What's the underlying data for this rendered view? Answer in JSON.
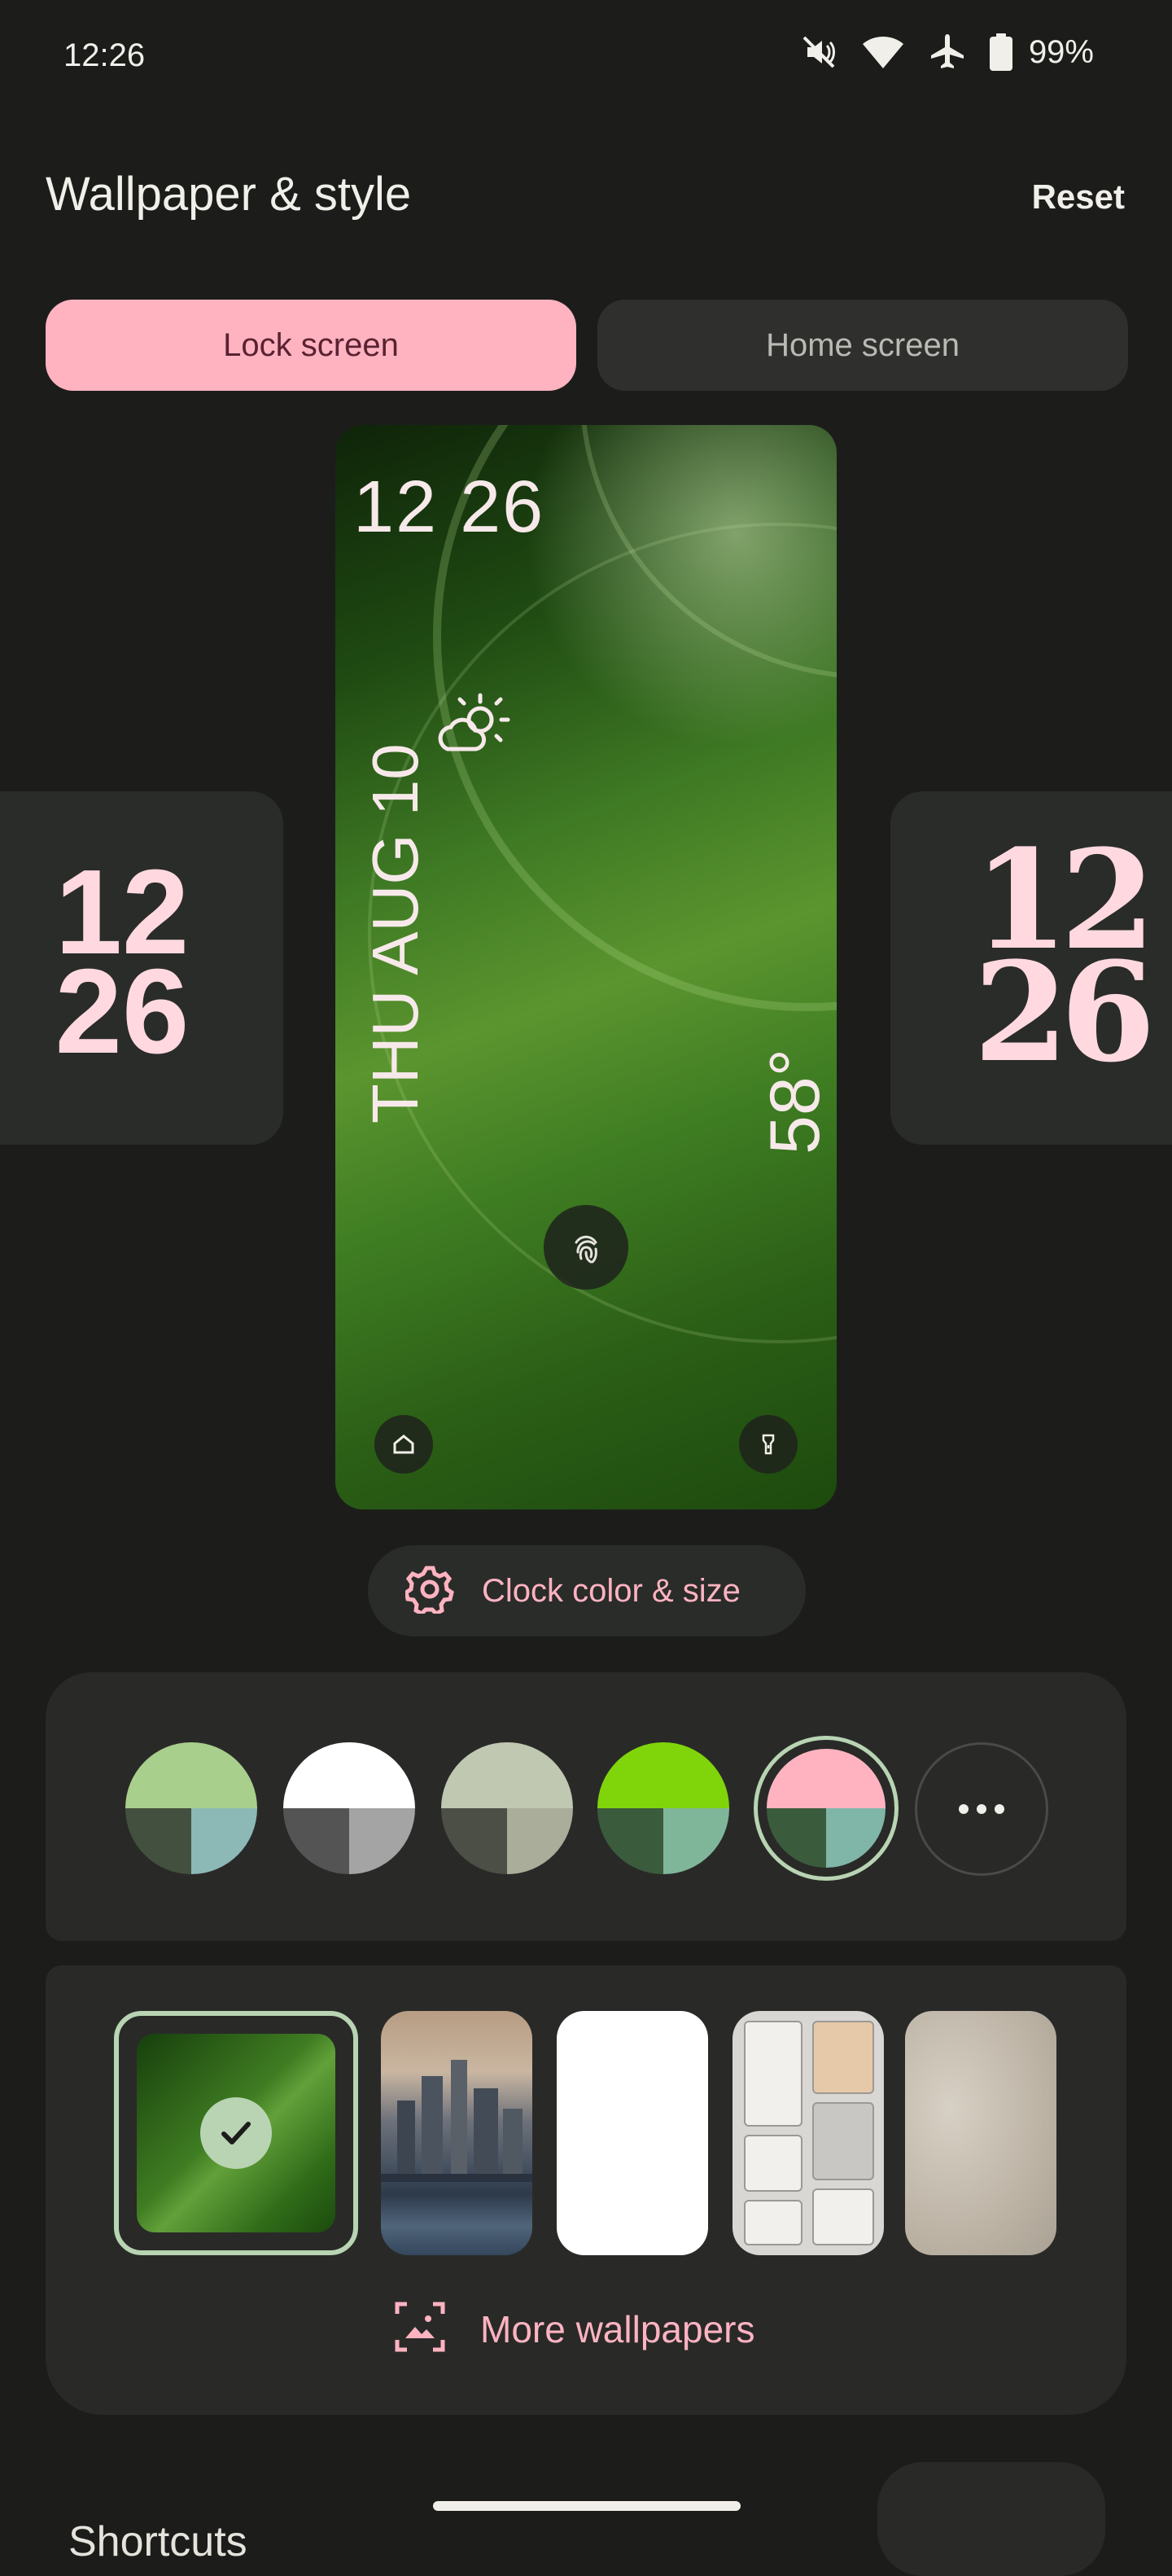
{
  "status_bar": {
    "time": "12:26",
    "battery": "99%",
    "icons": [
      "mute-icon",
      "wifi-icon",
      "airplane-icon",
      "battery-icon"
    ]
  },
  "header": {
    "title": "Wallpaper & style",
    "reset": "Reset"
  },
  "tabs": [
    {
      "label": "Lock screen",
      "selected": true
    },
    {
      "label": "Home screen",
      "selected": false
    }
  ],
  "clock_previews": {
    "left": {
      "hour": "12",
      "minute": "26"
    },
    "right": {
      "hour": "12",
      "minute": "26"
    }
  },
  "lock_preview": {
    "time": "12 26",
    "date": "THU AUG 10",
    "temperature": "58°",
    "weather_icon": "partly-sunny-icon",
    "controls": [
      "fingerprint-icon",
      "home-icon",
      "flashlight-icon"
    ]
  },
  "clock_color_button": {
    "label": "Clock color & size",
    "icon": "gear-icon"
  },
  "color_options": [
    {
      "top": "#a9cf8c",
      "bottom_left": "#43503f",
      "bottom_right": "#8cb8b6",
      "selected": false
    },
    {
      "top": "#ffffff",
      "bottom_left": "#545454",
      "bottom_right": "#a4a4a4",
      "selected": false
    },
    {
      "top": "#c0c8b2",
      "bottom_left": "#4b4f45",
      "bottom_right": "#a9ad99",
      "selected": false
    },
    {
      "top": "#7fd50a",
      "bottom_left": "#3b5b3d",
      "bottom_right": "#7fb69a",
      "selected": false
    },
    {
      "top": "#ffb3c1",
      "bottom_left": "#3b5b3d",
      "bottom_right": "#7fb6a8",
      "selected": true
    }
  ],
  "more_colors_icon": "more-horizontal-icon",
  "wallpapers": {
    "items": [
      "leaf-green",
      "city-skyline",
      "plain-white",
      "device-parts-grid",
      "beige-fabric"
    ],
    "selected_index": 0,
    "more_label": "More wallpapers",
    "more_icon": "image-gallery-icon"
  },
  "bottom": {
    "shortcuts_label": "Shortcuts"
  },
  "accent_colors": {
    "pink": "#ffb3c1",
    "selection_ring": "#b8d4b3",
    "panel": "#292a28",
    "background": "#1c1d1b"
  }
}
